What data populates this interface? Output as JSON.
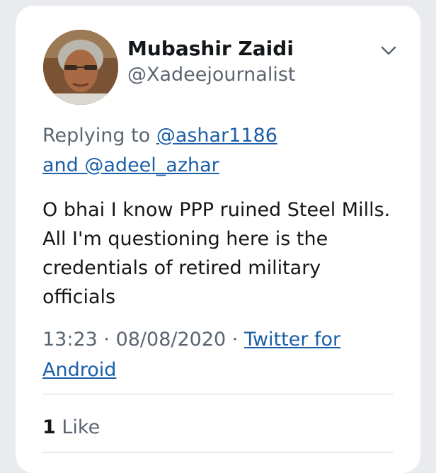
{
  "tweet": {
    "author_name": "Mubashir Zaidi",
    "author_handle": "@Xadeejournalist",
    "replying_prefix": "Replying to ",
    "reply_mention_1": "@ashar1186",
    "reply_joiner": "and ",
    "reply_mention_2": "@adeel_azhar",
    "text": "O bhai I know PPP ruined Steel Mills. All I'm questioning here is the credentials of retired military officials",
    "time": "13:23",
    "separator": " · ",
    "date": "08/08/2020",
    "source_label": "Twitter for Android",
    "like_count": "1",
    "like_label": " Like"
  },
  "icons": {
    "menu": "chevron-down-icon",
    "avatar": "avatar-photo"
  },
  "colors": {
    "link": "#1b5fa8",
    "secondary_text": "#5b6570",
    "primary_text": "#14171a"
  }
}
